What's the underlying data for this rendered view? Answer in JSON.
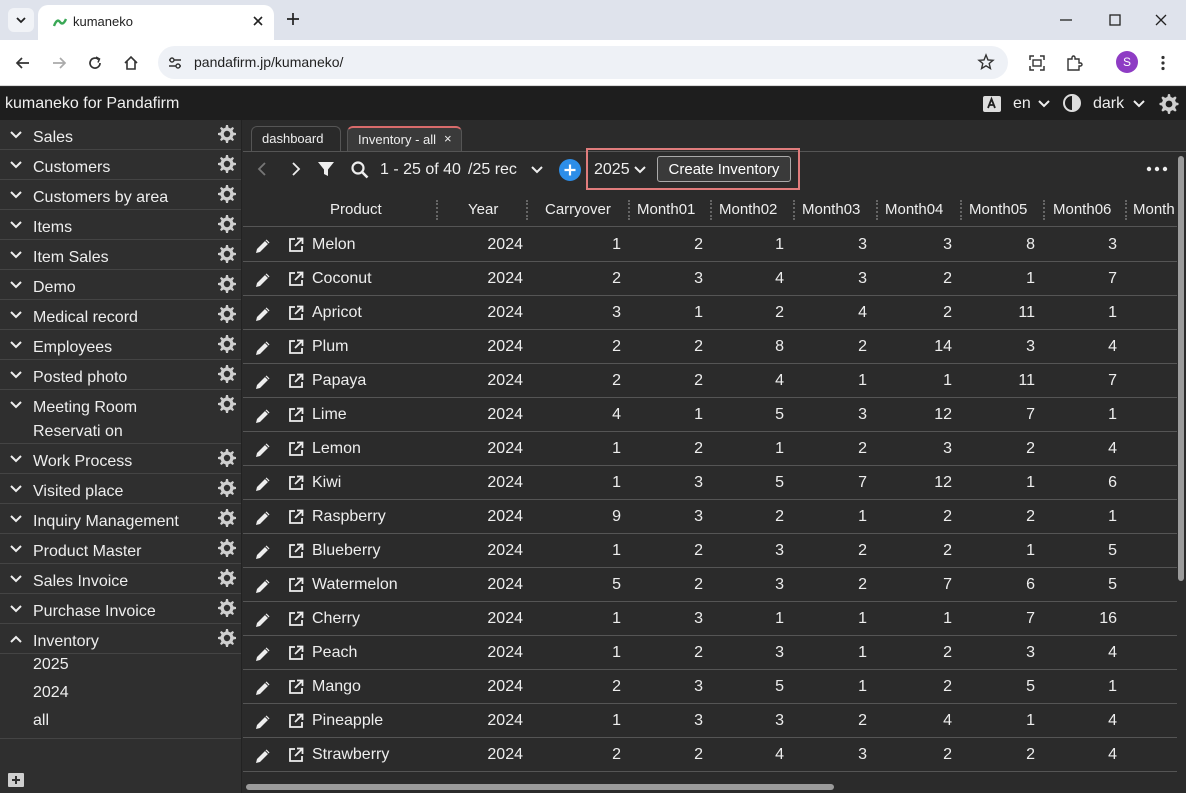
{
  "browser": {
    "tab_title": "kumaneko",
    "url": "pandafirm.jp/kumaneko/",
    "avatar_letter": "S"
  },
  "app": {
    "title": "kumaneko for Pandafirm",
    "language": "en",
    "theme": "dark"
  },
  "sidebar": {
    "items": [
      {
        "label": "Sales"
      },
      {
        "label": "Customers"
      },
      {
        "label": "Customers by area"
      },
      {
        "label": "Items"
      },
      {
        "label": "Item Sales"
      },
      {
        "label": "Demo"
      },
      {
        "label": "Medical record"
      },
      {
        "label": "Employees"
      },
      {
        "label": "Posted photo"
      },
      {
        "label": "Meeting Room Reservati on"
      },
      {
        "label": "Work Process"
      },
      {
        "label": "Visited place"
      },
      {
        "label": "Inquiry Management"
      },
      {
        "label": "Product Master"
      },
      {
        "label": "Sales Invoice"
      },
      {
        "label": "Purchase Invoice"
      },
      {
        "label": "Inventory"
      }
    ],
    "inventory_subitems": [
      "2025",
      "2024",
      "all"
    ]
  },
  "main": {
    "tabs": [
      {
        "label": "dashboard"
      },
      {
        "label": "Inventory - all",
        "close": "×"
      }
    ],
    "toolbar": {
      "range": "1 - 25 of 40",
      "per_page": "/25 rec",
      "year": "2025",
      "create_label": "Create Inventory"
    },
    "columns": [
      "Product",
      "Year",
      "Carryover",
      "Month01",
      "Month02",
      "Month03",
      "Month04",
      "Month05",
      "Month06",
      "Month"
    ],
    "rows": [
      {
        "product": "Melon",
        "year": "2024",
        "vals": [
          "1",
          "2",
          "1",
          "3",
          "3",
          "8",
          "3"
        ]
      },
      {
        "product": "Coconut",
        "year": "2024",
        "vals": [
          "2",
          "3",
          "4",
          "3",
          "2",
          "1",
          "7"
        ]
      },
      {
        "product": "Apricot",
        "year": "2024",
        "vals": [
          "3",
          "1",
          "2",
          "4",
          "2",
          "11",
          "1"
        ]
      },
      {
        "product": "Plum",
        "year": "2024",
        "vals": [
          "2",
          "2",
          "8",
          "2",
          "14",
          "3",
          "4"
        ]
      },
      {
        "product": "Papaya",
        "year": "2024",
        "vals": [
          "2",
          "2",
          "4",
          "1",
          "1",
          "11",
          "7"
        ]
      },
      {
        "product": "Lime",
        "year": "2024",
        "vals": [
          "4",
          "1",
          "5",
          "3",
          "12",
          "7",
          "1"
        ]
      },
      {
        "product": "Lemon",
        "year": "2024",
        "vals": [
          "1",
          "2",
          "1",
          "2",
          "3",
          "2",
          "4"
        ]
      },
      {
        "product": "Kiwi",
        "year": "2024",
        "vals": [
          "1",
          "3",
          "5",
          "7",
          "12",
          "1",
          "6"
        ]
      },
      {
        "product": "Raspberry",
        "year": "2024",
        "vals": [
          "9",
          "3",
          "2",
          "1",
          "2",
          "2",
          "1"
        ]
      },
      {
        "product": "Blueberry",
        "year": "2024",
        "vals": [
          "1",
          "2",
          "3",
          "2",
          "2",
          "1",
          "5"
        ]
      },
      {
        "product": "Watermelon",
        "year": "2024",
        "vals": [
          "5",
          "2",
          "3",
          "2",
          "7",
          "6",
          "5"
        ]
      },
      {
        "product": "Cherry",
        "year": "2024",
        "vals": [
          "1",
          "3",
          "1",
          "1",
          "1",
          "7",
          "16"
        ]
      },
      {
        "product": "Peach",
        "year": "2024",
        "vals": [
          "1",
          "2",
          "3",
          "1",
          "2",
          "3",
          "4"
        ]
      },
      {
        "product": "Mango",
        "year": "2024",
        "vals": [
          "2",
          "3",
          "5",
          "1",
          "2",
          "5",
          "1"
        ]
      },
      {
        "product": "Pineapple",
        "year": "2024",
        "vals": [
          "1",
          "3",
          "3",
          "2",
          "4",
          "1",
          "4"
        ]
      },
      {
        "product": "Strawberry",
        "year": "2024",
        "vals": [
          "2",
          "2",
          "4",
          "3",
          "2",
          "2",
          "4"
        ]
      }
    ]
  }
}
